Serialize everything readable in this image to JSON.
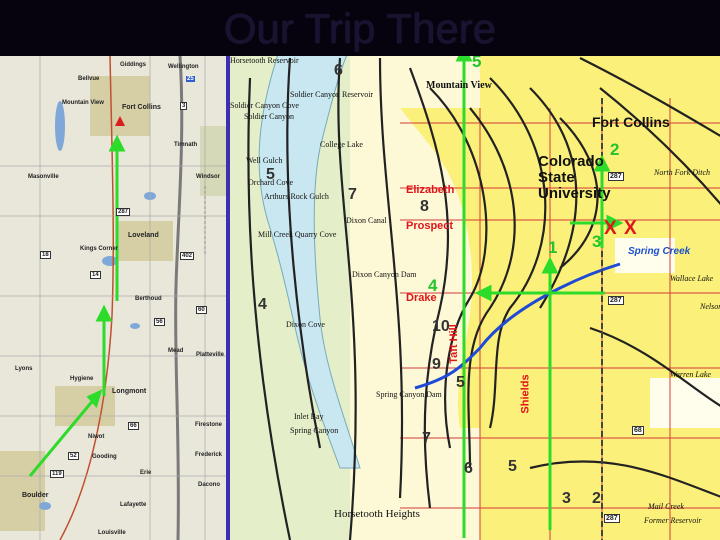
{
  "title": "Our Trip There",
  "left_map": {
    "towns": [
      "Bellvue",
      "Giddings",
      "Mountain View",
      "Fort Collins",
      "Timnath",
      "Windsor",
      "Masonville",
      "Loveland",
      "Kings Corner",
      "Berthoud",
      "Wellington",
      "Lyons",
      "Hygiene",
      "Longmont",
      "Mead",
      "Platteville",
      "Niwot",
      "Gooding",
      "Erie",
      "Boulder",
      "Lafayette",
      "Louisville",
      "Firestone",
      "Frederick",
      "Dacono"
    ],
    "road_numbers": [
      "3",
      "287",
      "25",
      "14",
      "18",
      "402",
      "60",
      "56",
      "66",
      "52",
      "119"
    ]
  },
  "right_map": {
    "place_labels": [
      "Horsetooth Reservoir",
      "Soldier Canyon Reservoir",
      "Soldier Canyon Cove",
      "Soldier Canyon",
      "Mountain View",
      "Well Gulch",
      "College Lake",
      "Orchard Cove",
      "Arthurs Rock Gulch",
      "Dixon Canal",
      "Mill Creek Quarry Cove",
      "Dixon Canyon Dam",
      "Dixon Cove",
      "Inlet Bay",
      "Spring Canyon",
      "Spring Canyon Dam",
      "Horsetooth Heights",
      "Fort Collins",
      "Wallace Lake",
      "Warren Lake",
      "Mail Creek",
      "Former Reservoir",
      "North Fork Ditch",
      "Nelson"
    ],
    "campus_label": "Colorado State University",
    "streets": [
      "Elizabeth",
      "Prospect",
      "Drake",
      "Shields",
      "Taft Hill"
    ],
    "creeks": [
      "Spring Creek"
    ],
    "route_numbers": [
      "5",
      "2",
      "3",
      "4",
      "1"
    ],
    "contour_numbers": [
      "6",
      "5",
      "7",
      "8",
      "4",
      "10",
      "9",
      "5",
      "7",
      "6",
      "5",
      "3",
      "2"
    ],
    "markers": [
      "X",
      "X"
    ],
    "road_shields": [
      "287",
      "287",
      "68",
      "287"
    ]
  }
}
